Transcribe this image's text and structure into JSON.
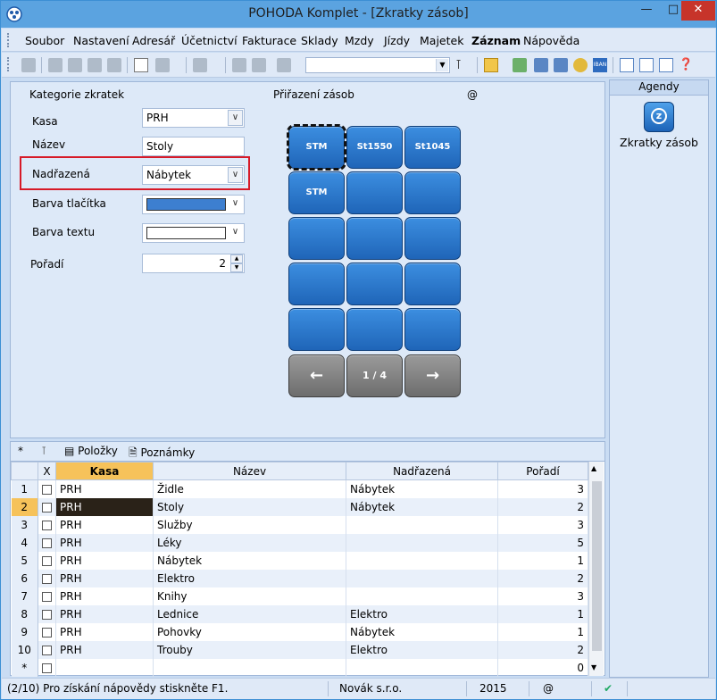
{
  "window": {
    "title": "POHODA Komplet - [Zkratky zásob]"
  },
  "menu": [
    "Soubor",
    "Nastavení",
    "Adresář",
    "Účetnictví",
    "Fakturace",
    "Sklady",
    "Mzdy",
    "Jízdy",
    "Majetek",
    "Záznam",
    "Nápověda"
  ],
  "form": {
    "section_title": "Kategorie zkratek",
    "kasa_label": "Kasa",
    "kasa_value": "PRH",
    "nazev_label": "Název",
    "nazev_value": "Stoly",
    "nadrazena_label": "Nadřazená",
    "nadrazena_value": "Nábytek",
    "barva_tlacitka_label": "Barva tlačítka",
    "barva_tlacitka_color": "#3d7fd0",
    "barva_textu_label": "Barva textu",
    "barva_textu_color": "#ffffff",
    "poradi_label": "Pořadí",
    "poradi_value": "2"
  },
  "assignment": {
    "title": "Přiřazení zásob",
    "at_symbol": "@",
    "tiles": [
      "STM",
      "St1550",
      "St1045",
      "STM",
      "",
      "",
      "",
      "",
      "",
      "",
      "",
      "",
      "",
      "",
      ""
    ],
    "nav": {
      "prev": "←",
      "page": "1 / 4",
      "next": "→"
    }
  },
  "agendy": {
    "title": "Agendy",
    "item": "Zkratky zásob"
  },
  "tabs": {
    "star": "*",
    "items_tab": "Položky",
    "notes_tab": "Poznámky"
  },
  "grid": {
    "columns": [
      "X",
      "Kasa",
      "Název",
      "Nadřazená",
      "Pořadí"
    ],
    "rows": [
      {
        "n": "1",
        "kasa": "PRH",
        "nazev": "Židle",
        "nad": "Nábytek",
        "por": "3"
      },
      {
        "n": "2",
        "kasa": "PRH",
        "nazev": "Stoly",
        "nad": "Nábytek",
        "por": "2"
      },
      {
        "n": "3",
        "kasa": "PRH",
        "nazev": "Služby",
        "nad": "",
        "por": "3"
      },
      {
        "n": "4",
        "kasa": "PRH",
        "nazev": "Léky",
        "nad": "",
        "por": "5"
      },
      {
        "n": "5",
        "kasa": "PRH",
        "nazev": "Nábytek",
        "nad": "",
        "por": "1"
      },
      {
        "n": "6",
        "kasa": "PRH",
        "nazev": "Elektro",
        "nad": "",
        "por": "2"
      },
      {
        "n": "7",
        "kasa": "PRH",
        "nazev": "Knihy",
        "nad": "",
        "por": "3"
      },
      {
        "n": "8",
        "kasa": "PRH",
        "nazev": "Lednice",
        "nad": "Elektro",
        "por": "1"
      },
      {
        "n": "9",
        "kasa": "PRH",
        "nazev": "Pohovky",
        "nad": "Nábytek",
        "por": "1"
      },
      {
        "n": "10",
        "kasa": "PRH",
        "nazev": "Trouby",
        "nad": "Elektro",
        "por": "2"
      },
      {
        "n": "*",
        "kasa": "",
        "nazev": "",
        "nad": "",
        "por": "0"
      }
    ]
  },
  "status": {
    "hint": "(2/10) Pro získání nápovědy stiskněte F1.",
    "company": "Novák s.r.o.",
    "year": "2015",
    "at": "@"
  }
}
